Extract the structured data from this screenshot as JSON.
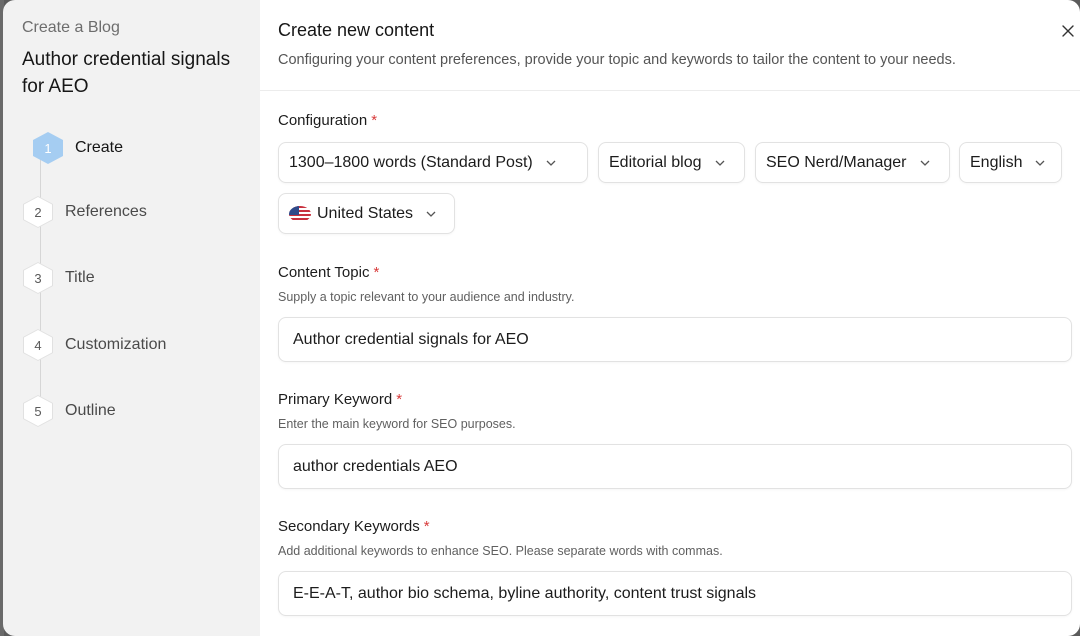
{
  "sidebar": {
    "eyebrow": "Create a Blog",
    "title": "Author credential signals for AEO",
    "steps": [
      {
        "number": "1",
        "label": "Create",
        "active": true
      },
      {
        "number": "2",
        "label": "References",
        "active": false
      },
      {
        "number": "3",
        "label": "Title",
        "active": false
      },
      {
        "number": "4",
        "label": "Customization",
        "active": false
      },
      {
        "number": "5",
        "label": "Outline",
        "active": false
      }
    ]
  },
  "panel": {
    "title": "Create new content",
    "subtitle": "Configuring your content preferences, provide your topic and keywords to tailor the content to your needs.",
    "close_icon": "close-icon"
  },
  "configuration": {
    "label": "Configuration",
    "required_mark": "*",
    "length": "1300–1800 words (Standard Post)",
    "style": "Editorial blog",
    "audience": "SEO Nerd/Manager",
    "language": "English",
    "country": "United States",
    "country_icon": "us-flag-icon"
  },
  "content_topic": {
    "label": "Content Topic",
    "required_mark": "*",
    "help": "Supply a topic relevant to your audience and industry.",
    "value": "Author credential signals for AEO"
  },
  "primary_keyword": {
    "label": "Primary Keyword",
    "required_mark": "*",
    "help": "Enter the main keyword for SEO purposes.",
    "value": "author credentials AEO"
  },
  "secondary_keywords": {
    "label": "Secondary Keywords",
    "required_mark": "*",
    "help": "Add additional keywords to enhance SEO. Please separate words with commas.",
    "value": "E-E-A-T, author bio schema, byline authority, content trust signals"
  },
  "colors": {
    "active_step": "#a5cdf2",
    "required": "#d83a3a",
    "sidebar_bg": "#f2f2f2"
  }
}
